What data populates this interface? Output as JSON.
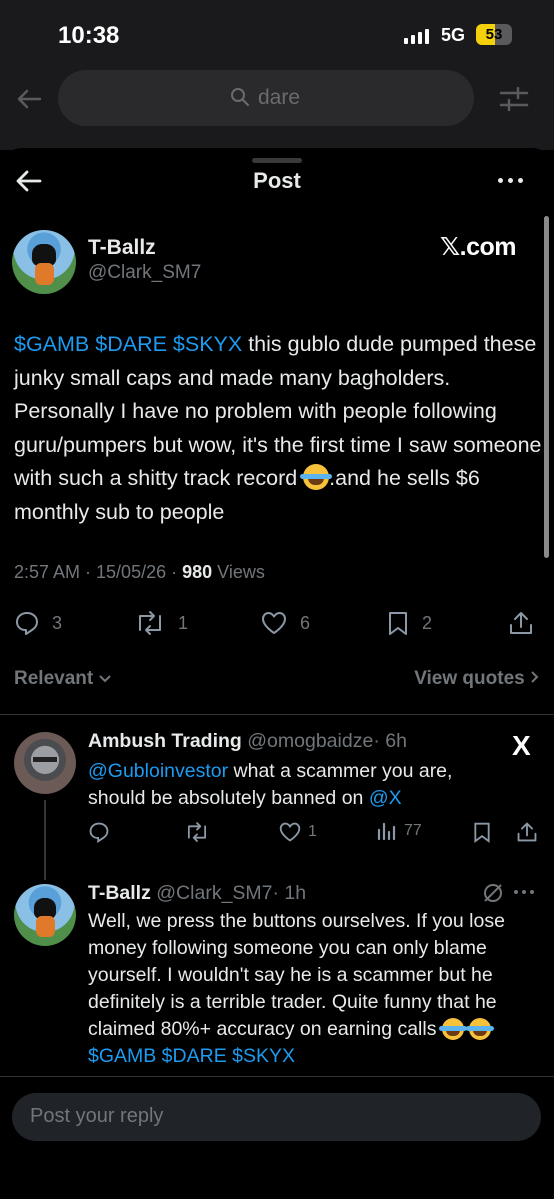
{
  "status_bar": {
    "time": "10:38",
    "network": "5G",
    "battery": "53",
    "battery_level": 0.53
  },
  "search": {
    "query": "dare"
  },
  "header": {
    "title": "Post"
  },
  "post": {
    "name": "T-Ballz",
    "handle": "@Clark_SM7",
    "source": "𝕏.com",
    "tickers": "$GAMB $DARE $SKYX",
    "text_1": " this gublo dude pumped these junky small caps and made many bagholders. Personally I have no problem with people following guru/pumpers but wow, it's the first time I saw someone with such a shitty track record ",
    "text_2": ".and he sells $6 monthly sub to people",
    "timestamp": "2:57 AM · 15/05/26 · ",
    "views_count": "980",
    "views_label": " Views",
    "replies": "3",
    "reposts": "1",
    "likes": "6",
    "bookmarks": "2"
  },
  "sort": {
    "label": "Relevant",
    "view_quotes": "View quotes"
  },
  "replies": [
    {
      "name": "Ambush Trading",
      "handle": "@omogbaidze",
      "time": "· 6h",
      "mention": "@Gubloinvestor",
      "text": " what a scammer you are, should be absolutely banned on ",
      "mention_2": "@X",
      "likes": "1",
      "views": "77"
    },
    {
      "name": "T-Ballz",
      "handle": "@Clark_SM7",
      "time": "· 1h",
      "text": "Well, we press the buttons ourselves. If you lose money following someone you can only blame yourself. I wouldn't say he is a scammer but he definitely is a terrible trader. Quite funny that he claimed 80%+ accuracy on earning calls ",
      "tickers": " $GAMB $DARE $SKYX"
    }
  ],
  "reply_box": {
    "placeholder": "Post your reply"
  }
}
